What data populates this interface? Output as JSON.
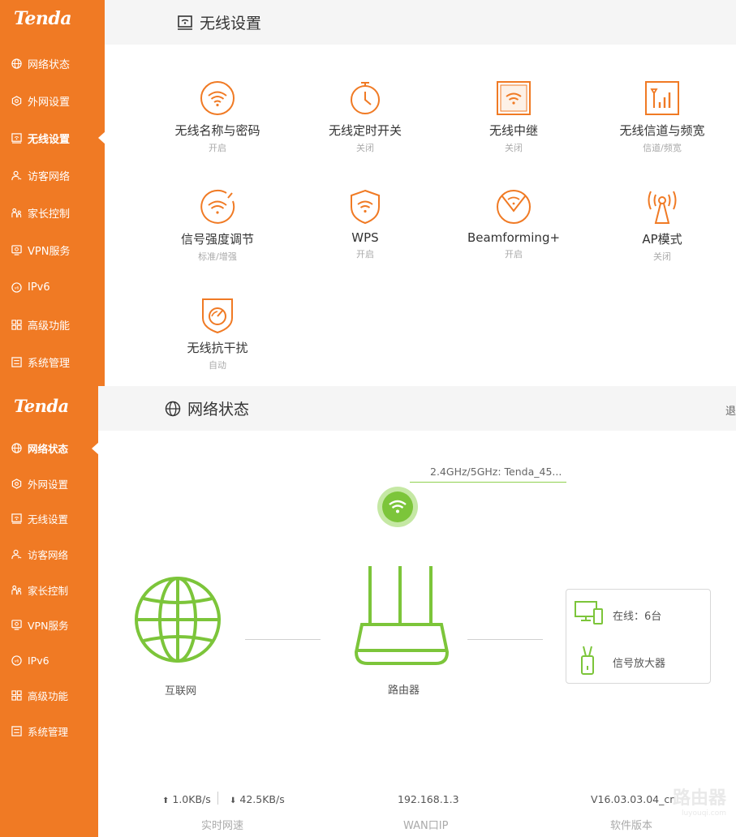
{
  "wireless": {
    "brand": "Tenda",
    "title": "无线设置",
    "nav": [
      {
        "label": "网络状态",
        "icon": "globe-icon"
      },
      {
        "label": "外网设置",
        "icon": "wan-icon"
      },
      {
        "label": "无线设置",
        "icon": "wifi-box-icon",
        "active": true
      },
      {
        "label": "访客网络",
        "icon": "guest-icon"
      },
      {
        "label": "家长控制",
        "icon": "parent-icon"
      },
      {
        "label": "VPN服务",
        "icon": "vpn-icon"
      },
      {
        "label": "IPv6",
        "icon": "ipv6-icon"
      },
      {
        "label": "高级功能",
        "icon": "grid-icon"
      },
      {
        "label": "系统管理",
        "icon": "settings-icon"
      }
    ],
    "cards": [
      {
        "name": "无线名称与密码",
        "status": "开启",
        "icon": "wifi-circle-icon"
      },
      {
        "name": "无线定时开关",
        "status": "关闭",
        "icon": "timer-icon"
      },
      {
        "name": "无线中继",
        "status": "关闭",
        "icon": "repeater-icon"
      },
      {
        "name": "无线信道与频宽",
        "status": "信道/频宽",
        "icon": "signal-bars-icon"
      },
      {
        "name": "信号强度调节",
        "status": "标准/增强",
        "icon": "signal-strength-icon"
      },
      {
        "name": "WPS",
        "status": "开启",
        "icon": "wps-shield-icon"
      },
      {
        "name": "Beamforming+",
        "status": "开启",
        "icon": "beamforming-icon"
      },
      {
        "name": "AP模式",
        "status": "关闭",
        "icon": "ap-tower-icon"
      },
      {
        "name": "无线抗干扰",
        "status": "自动",
        "icon": "anti-interference-icon"
      }
    ]
  },
  "status": {
    "brand": "Tenda",
    "title": "网络状态",
    "header_right": "退",
    "nav": [
      {
        "label": "网络状态",
        "icon": "globe-icon",
        "active": true
      },
      {
        "label": "外网设置",
        "icon": "wan-icon"
      },
      {
        "label": "无线设置",
        "icon": "wifi-box-icon"
      },
      {
        "label": "访客网络",
        "icon": "guest-icon"
      },
      {
        "label": "家长控制",
        "icon": "parent-icon"
      },
      {
        "label": "VPN服务",
        "icon": "vpn-icon"
      },
      {
        "label": "IPv6",
        "icon": "ipv6-icon"
      },
      {
        "label": "高级功能",
        "icon": "grid-icon"
      },
      {
        "label": "系统管理",
        "icon": "settings-icon"
      }
    ],
    "ssid": "2.4GHz/5GHz: Tenda_45...",
    "internet_label": "互联网",
    "router_label": "路由器",
    "online_label": "在线：6台",
    "extender_label": "信号放大器",
    "upload": "1.0KB/s",
    "download": "42.5KB/s",
    "speed_caption": "实时网速",
    "wan_ip": "192.168.1.3",
    "wan_caption": "WAN口IP",
    "version": "V16.03.03.04_cn",
    "version_caption": "软件版本",
    "watermark": "路由器",
    "watermark_sub": "luyouqi.com",
    "colors": {
      "orange": "#f07a24",
      "green": "#7cc53a"
    }
  }
}
